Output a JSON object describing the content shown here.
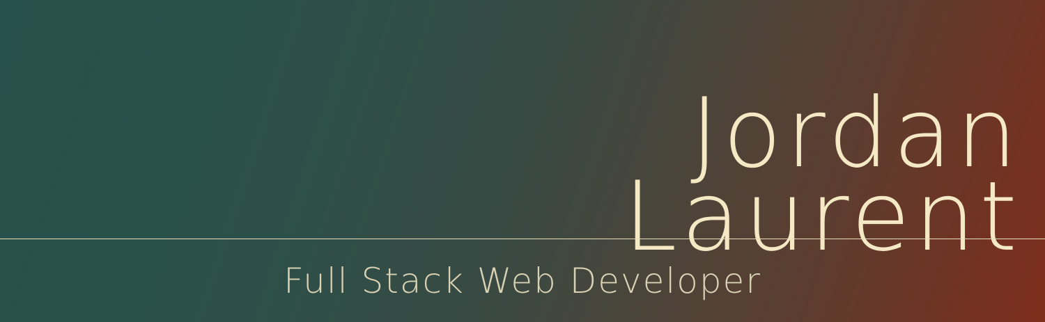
{
  "hero": {
    "first_name": "Jordan",
    "last_name": "Laurent",
    "subtitle": "Full Stack Web Developer"
  },
  "colors": {
    "text": "#f4e9c4",
    "subtitle": "#d9d2b4",
    "divider": "#e9dfba",
    "gradient_start": "#27514c",
    "gradient_end": "#7f2e1d"
  }
}
